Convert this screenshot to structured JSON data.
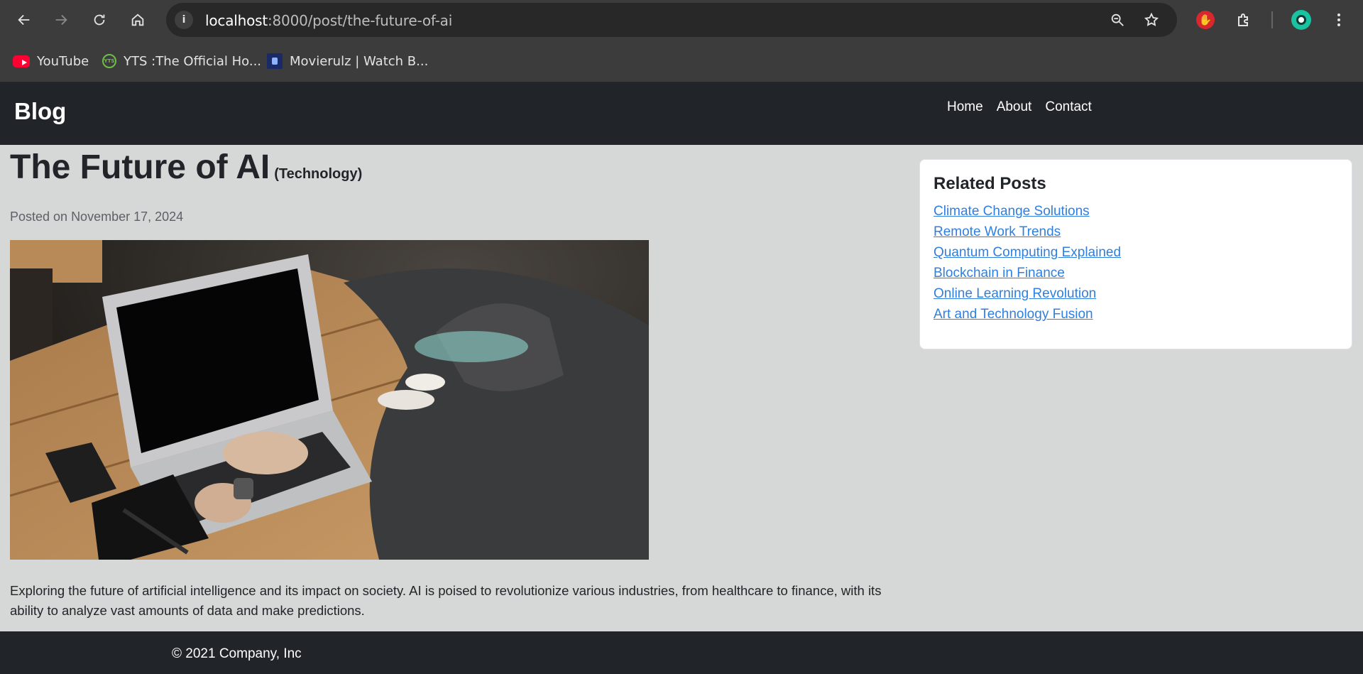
{
  "browser": {
    "url_host": "localhost",
    "url_path": ":8000/post/the-future-of-ai",
    "bookmarks": [
      {
        "label": "YouTube",
        "icon": "youtube-icon"
      },
      {
        "label": "YTS :The Official Ho...",
        "icon": "yts-icon"
      },
      {
        "label": "Movierulz | Watch B...",
        "icon": "movierulz-icon"
      }
    ]
  },
  "site": {
    "brand": "Blog",
    "nav": [
      "Home",
      "About",
      "Contact"
    ]
  },
  "post": {
    "title": "The Future of AI",
    "category": "(Technology)",
    "posted": "Posted on November 17, 2024",
    "body": "Exploring the future of artificial intelligence and its impact on society. AI is poised to revolutionize various industries, from healthcare to finance, with its ability to analyze vast amounts of data and make predictions."
  },
  "sidebar": {
    "title": "Related Posts",
    "links": [
      "Climate Change Solutions",
      "Remote Work Trends",
      "Quantum Computing Explained",
      "Blockchain in Finance",
      "Online Learning Revolution",
      "Art and Technology Fusion"
    ]
  },
  "footer": {
    "text": "© 2021 Company, Inc"
  },
  "colors": {
    "navbar": "#212529",
    "page_bg": "#d6d8d7",
    "link": "#2f7fdf"
  }
}
